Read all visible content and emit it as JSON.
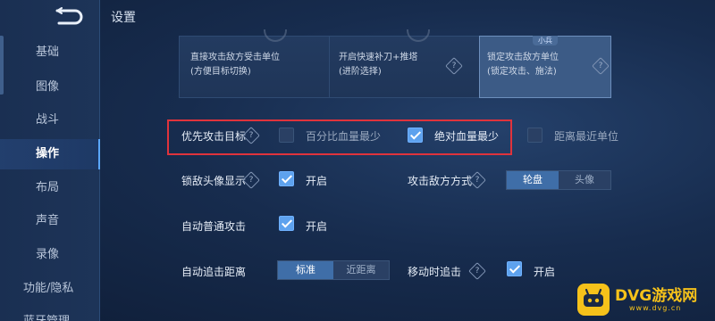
{
  "page_title": "设置",
  "sidebar": {
    "items": [
      {
        "label": "基础"
      },
      {
        "label": "图像"
      },
      {
        "label": "战斗"
      },
      {
        "label": "操作"
      },
      {
        "label": "布局"
      },
      {
        "label": "声音"
      },
      {
        "label": "录像"
      },
      {
        "label": "功能/隐私"
      },
      {
        "label": "蓝牙管理"
      }
    ],
    "active": "操作"
  },
  "target_cards": [
    {
      "line1": "直接攻击敌方受击单位",
      "line2": "(方便目标切换)"
    },
    {
      "line1": "开启快速补刀+推塔",
      "line2": "(进阶选择)"
    },
    {
      "line1": "锁定攻击敌方单位",
      "line2": "(锁定攻击、施法)",
      "tag": "小兵",
      "selected": true
    }
  ],
  "priority_row": {
    "label": "优先攻击目标",
    "options": [
      {
        "label": "百分比血量最少",
        "checked": false
      },
      {
        "label": "绝对血量最少",
        "checked": true
      },
      {
        "label": "距离最近单位",
        "checked": false
      }
    ]
  },
  "lock_avatar": {
    "label": "锁敌头像显示",
    "value_label": "开启",
    "checked": true
  },
  "attack_mode": {
    "label": "攻击敌方方式",
    "options": [
      "轮盘",
      "头像"
    ],
    "selected": "轮盘"
  },
  "auto_attack": {
    "label": "自动普通攻击",
    "value_label": "开启",
    "checked": true
  },
  "auto_chase": {
    "label": "自动追击距离",
    "options": [
      "标准",
      "近距离"
    ],
    "selected": "标准"
  },
  "move_chase": {
    "label": "移动时追击",
    "value_label": "开启",
    "checked": true
  },
  "help_icon_text": "?",
  "watermark": {
    "title": "DVG游戏网",
    "sub": "www.dvg.cn"
  },
  "colors": {
    "accent": "#5ea2ee",
    "highlight": "#e0333c",
    "watermark": "#f6c21a"
  }
}
